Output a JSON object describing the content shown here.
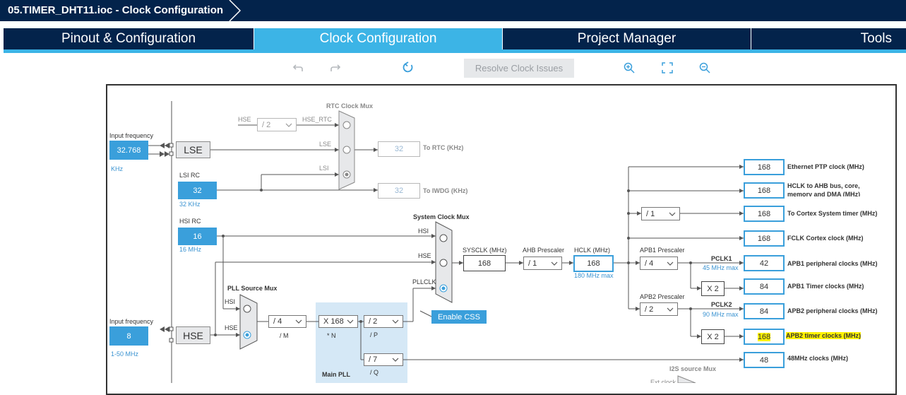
{
  "window": {
    "title": "05.TIMER_DHT11.ioc - Clock Configuration"
  },
  "tabs": [
    {
      "label": "Pinout & Configuration"
    },
    {
      "label": "Clock Configuration"
    },
    {
      "label": "Project Manager"
    },
    {
      "label": "Tools"
    }
  ],
  "toolbar": {
    "resolve_label": "Resolve Clock Issues",
    "icons": [
      "undo-icon",
      "redo-icon",
      "refresh-icon",
      "zoom-in-icon",
      "fit-screen-icon",
      "zoom-out-icon"
    ]
  },
  "colors": {
    "navy": "#03234b",
    "accent": "#3cb4e6",
    "box_blue": "#3a9fdb",
    "highlight": "#fff200"
  },
  "diagram": {
    "lse": {
      "input_label": "Input frequency",
      "input_value": "32.768",
      "unit": "KHz",
      "block": "LSE"
    },
    "lsi": {
      "label": "LSI RC",
      "value": "32",
      "unit": "32 KHz"
    },
    "hsi": {
      "label": "HSI RC",
      "value": "16",
      "unit": "16 MHz"
    },
    "hse": {
      "input_label": "Input frequency",
      "input_value": "8",
      "range": "1-50 MHz",
      "block": "HSE"
    },
    "rtc_mux": {
      "title": "RTC Clock Mux",
      "hse": "HSE",
      "hse_div": "/ 2",
      "hse_rtc": "HSE_RTC",
      "lse": "LSE",
      "lsi": "LSI",
      "to_rtc_value": "32",
      "to_rtc_label": "To RTC (KHz)",
      "to_iwdg_value": "32",
      "to_iwdg_label": "To IWDG (KHz)"
    },
    "sys_mux": {
      "title": "System Clock Mux",
      "hsi": "HSI",
      "hse": "HSE",
      "pllclk": "PLLCLK",
      "enable_css": "Enable CSS"
    },
    "pll_source": {
      "title": "PLL Source Mux",
      "hsi": "HSI",
      "hse": "HSE"
    },
    "pll": {
      "m_value": "/ 4",
      "m_label": "/ M",
      "n_value": "X 168",
      "n_label": "* N",
      "p_value": "/ 2",
      "p_label": "/ P",
      "q_value": "/ 7",
      "q_label": "/ Q",
      "title": "Main PLL"
    },
    "sysclk": {
      "label": "SYSCLK (MHz)",
      "value": "168"
    },
    "ahb": {
      "label": "AHB Prescaler",
      "value": "/ 1"
    },
    "hclk": {
      "label": "HCLK (MHz)",
      "value": "168",
      "max": "180 MHz max"
    },
    "apb1": {
      "label": "APB1 Prescaler",
      "value": "/ 4",
      "pclk": "PCLK1",
      "max": "45 MHz max",
      "mult": "X 2"
    },
    "apb2": {
      "label": "APB2 Prescaler",
      "value": "/ 2",
      "pclk": "PCLK2",
      "max": "90 MHz max",
      "mult": "X 2"
    },
    "cortex_div": "/ 1",
    "i2s_mux": {
      "title": "I2S source Mux",
      "partial": "Ext clock"
    },
    "outputs": [
      {
        "value": "168",
        "label": "Ethernet PTP clock (MHz)"
      },
      {
        "value": "168",
        "label": "HCLK to AHB bus, core, memory and DMA (MHz)"
      },
      {
        "value": "168",
        "label": "To Cortex System timer (MHz)"
      },
      {
        "value": "168",
        "label": "FCLK Cortex clock (MHz)"
      },
      {
        "value": "42",
        "label": "APB1 peripheral clocks (MHz)"
      },
      {
        "value": "84",
        "label": "APB1 Timer clocks (MHz)"
      },
      {
        "value": "84",
        "label": "APB2 peripheral clocks (MHz)"
      },
      {
        "value": "168",
        "label": "APB2 timer clocks (MHz)"
      },
      {
        "value": "48",
        "label": "48MHz clocks (MHz)"
      }
    ]
  }
}
